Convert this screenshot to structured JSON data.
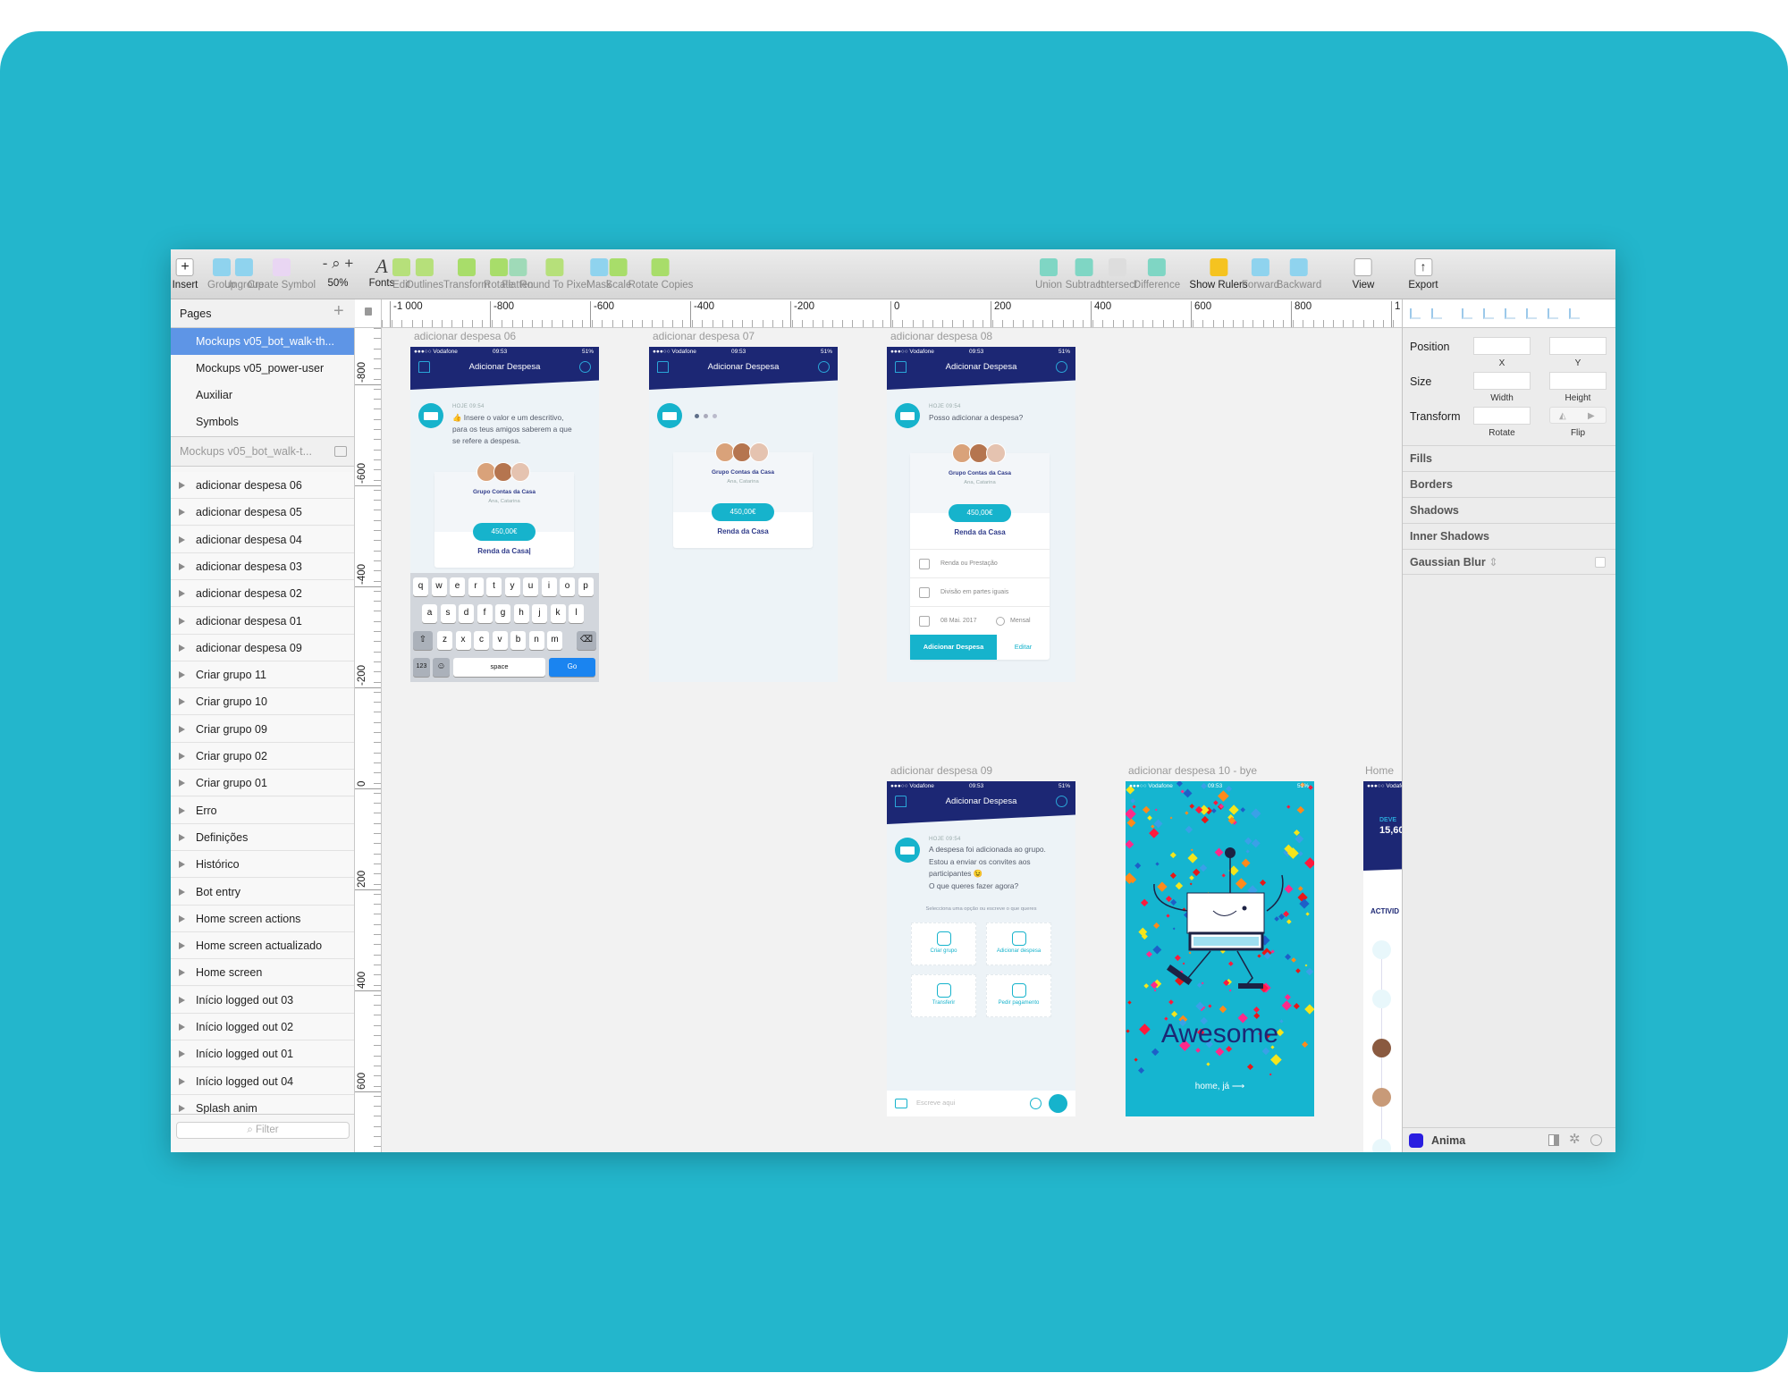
{
  "colors": {
    "background": "#23b6cc",
    "selection": "#5e95e6",
    "navy": "#1c2774",
    "teal": "#16b3cc"
  },
  "toolbar": {
    "items": [
      {
        "label": "Insert",
        "icon": "plus-icon",
        "active": true
      },
      {
        "label": "Group",
        "icon": "group-icon",
        "active": false
      },
      {
        "label": "Ungroup",
        "icon": "ungroup-icon",
        "active": false
      },
      {
        "label": "Create Symbol",
        "icon": "symbol-icon",
        "active": false
      },
      {
        "label": "50%",
        "icon": "zoom-icon",
        "active": true
      },
      {
        "label": "Fonts",
        "icon": "font-icon",
        "active": true
      },
      {
        "label": "Edit",
        "icon": "edit-icon",
        "active": false
      },
      {
        "label": "Outlines",
        "icon": "outlines-icon",
        "active": false
      },
      {
        "label": "Transform",
        "icon": "transform-icon",
        "active": false
      },
      {
        "label": "Rotate",
        "icon": "rotate-icon",
        "active": false
      },
      {
        "label": "Flatten",
        "icon": "flatten-icon",
        "active": false
      },
      {
        "label": "Round To Pixel",
        "icon": "round-to-pixel-icon",
        "active": false
      },
      {
        "label": "Mask",
        "icon": "mask-icon",
        "active": false
      },
      {
        "label": "Scale",
        "icon": "scale-icon",
        "active": false
      },
      {
        "label": "Rotate Copies",
        "icon": "rotate-copies-icon",
        "active": false
      },
      {
        "label": "Union",
        "icon": "union-icon",
        "active": false
      },
      {
        "label": "Subtract",
        "icon": "subtract-icon",
        "active": false
      },
      {
        "label": "Intersect",
        "icon": "intersect-icon",
        "active": false
      },
      {
        "label": "Difference",
        "icon": "difference-icon",
        "active": false
      },
      {
        "label": "Show Rulers",
        "icon": "ruler-icon",
        "active": true
      },
      {
        "label": "Forward",
        "icon": "forward-icon",
        "active": false
      },
      {
        "label": "Backward",
        "icon": "backward-icon",
        "active": false
      },
      {
        "label": "View",
        "icon": "view-icon",
        "active": true
      },
      {
        "label": "Export",
        "icon": "export-icon",
        "active": true
      }
    ]
  },
  "sidebar": {
    "pages_title": "Pages",
    "pages": [
      "Mockups v05_bot_walk-th...",
      "Mockups v05_power-user",
      "Auxiliar",
      "Symbols"
    ],
    "selected_page": 0,
    "document_title": "Mockups v05_bot_walk-t...",
    "layers": [
      "adicionar despesa 06",
      "adicionar despesa 05",
      "adicionar despesa 04",
      "adicionar despesa 03",
      "adicionar despesa 02",
      "adicionar despesa 01",
      "adicionar despesa 09",
      "Criar grupo 11",
      "Criar grupo 10",
      "Criar grupo 09",
      "Criar grupo 02",
      "Criar grupo 01",
      "Erro",
      "Definições",
      "Histórico",
      "Bot entry",
      "Home screen actions",
      "Home screen actualizado",
      "Home screen",
      "Início logged out 03",
      "Início logged out 02",
      "Início logged out 01",
      "Início logged out 04",
      "Splash anim"
    ],
    "filter_placeholder": "Filter"
  },
  "rulers": {
    "horizontal": [
      "-1 000",
      "-800",
      "-600",
      "-400",
      "-200",
      "0",
      "200",
      "400",
      "600",
      "800",
      "1"
    ],
    "vertical": [
      "-800",
      "-600",
      "-400",
      "-200",
      "0",
      "200",
      "400",
      "600"
    ]
  },
  "inspector": {
    "position": "Position",
    "x": "X",
    "y": "Y",
    "size": "Size",
    "width": "Width",
    "height": "Height",
    "transform": "Transform",
    "rotate": "Rotate",
    "flip": "Flip",
    "sections": [
      "Fills",
      "Borders",
      "Shadows",
      "Inner Shadows",
      "Gaussian Blur"
    ],
    "plugin": "Anima"
  },
  "phone": {
    "carrier": "●●●○○ Vodafone",
    "time": "09:53",
    "battery": "51%",
    "title": "Adicionar Despesa",
    "timestamp": "HOJE 09:54"
  },
  "artboards": {
    "a06": {
      "label": "adicionar despesa 06",
      "message": [
        "👍 Insere o valor e um descritivo,",
        "para os teus amigos saberem a que",
        "se refere a despesa."
      ],
      "group": "Grupo Contas da Casa",
      "members": "Ana, Catarina",
      "amount": "450,00€",
      "description": "Renda da Casa|",
      "keys": [
        [
          "q",
          "w",
          "e",
          "r",
          "t",
          "y",
          "u",
          "i",
          "o",
          "p"
        ],
        [
          "a",
          "s",
          "d",
          "f",
          "g",
          "h",
          "j",
          "k",
          "l"
        ],
        [
          "z",
          "x",
          "c",
          "v",
          "b",
          "n",
          "m"
        ]
      ],
      "key_123": "123",
      "key_space": "space",
      "key_go": "Go"
    },
    "a07": {
      "label": "adicionar despesa 07",
      "group": "Grupo Contas da Casa",
      "members": "Ana, Catarina",
      "amount": "450,00€",
      "description": "Renda da Casa"
    },
    "a08": {
      "label": "adicionar despesa 08",
      "message": "Posso adicionar a despesa?",
      "group": "Grupo Contas da Casa",
      "members": "Ana, Catarina",
      "amount": "450,00€",
      "description": "Renda da Casa",
      "category": "Renda ou Prestação",
      "split": "Divisão em partes iguais",
      "date": "08 Mai. 2017",
      "recurrence": "Mensal",
      "confirm": "Adicionar Despesa",
      "edit": "Editar"
    },
    "a09": {
      "label": "adicionar despesa 09",
      "message": [
        "A despesa foi adicionada ao grupo.",
        "Estou a enviar os convites aos",
        "participantes 😉",
        "O que queres fazer agora?"
      ],
      "hint": "Selecciona uma opção ou escreve o que queres",
      "options": [
        "Criar grupo",
        "Adicionar despesa",
        "Transferir",
        "Pedir pagamento"
      ],
      "input_placeholder": "Escreve aqui"
    },
    "a10": {
      "label": "adicionar despesa 10 - bye",
      "headline": "Awesome",
      "link": "home, já ⟶"
    },
    "home": {
      "label": "Home",
      "balance_label": "DEVE",
      "balance": "15,60",
      "section": "ACTIVID"
    }
  }
}
